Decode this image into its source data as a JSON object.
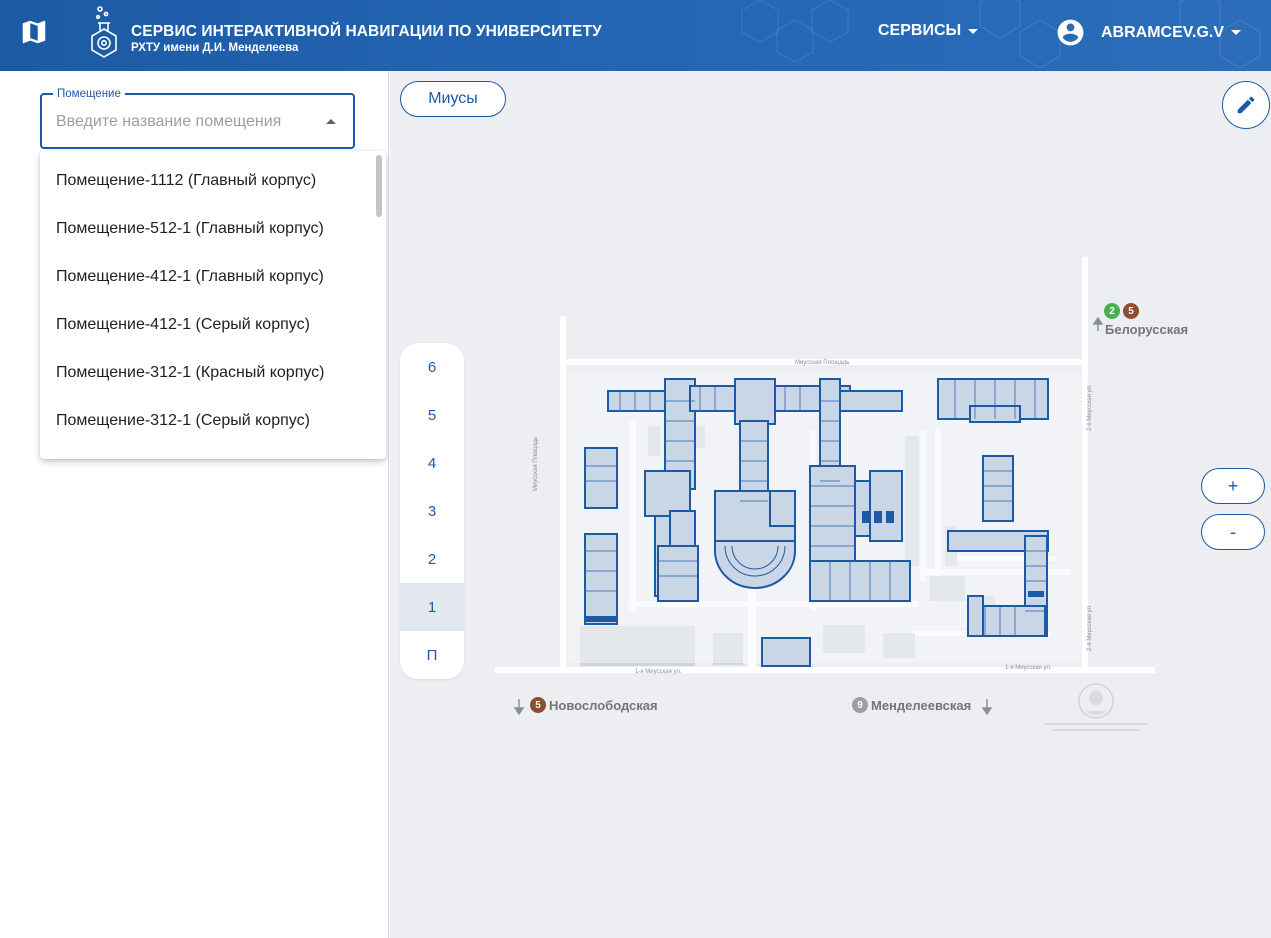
{
  "header": {
    "title": "СЕРВИС ИНТЕРАКТИВНОЙ НАВИГАЦИИ ПО УНИВЕРСИТЕТУ",
    "subtitle": "РХТУ имени Д.И. Менделеева",
    "services_label": "СЕРВИСЫ",
    "user_label": "ABRAMCEV.G.V",
    "map_icon": "map-icon",
    "logo_icon": "flask-logo-icon",
    "user_icon": "account-circle-icon"
  },
  "search": {
    "label": "Помещение",
    "placeholder": "Введите название помещения",
    "options": [
      "Помещение-1112 (Главный корпус)",
      "Помещение-512-1 (Главный корпус)",
      "Помещение-412-1 (Главный корпус)",
      "Помещение-412-1 (Серый корпус)",
      "Помещение-312-1 (Красный корпус)",
      "Помещение-312-1 (Серый корпус)"
    ]
  },
  "map": {
    "campus_label": "Миусы",
    "edit_icon": "pencil-icon",
    "floors": [
      "6",
      "5",
      "4",
      "3",
      "2",
      "1",
      "П"
    ],
    "active_floor": "1",
    "zoom_in": "+",
    "zoom_out": "-",
    "metro": {
      "belorusskaya": {
        "lines": [
          "2",
          "5"
        ],
        "name": "Белорусская"
      },
      "novoslobodskaya": {
        "line": "5",
        "name": "Новослободская"
      },
      "mendeleevskaya": {
        "line": "9",
        "name": "Менделеевская"
      }
    },
    "streets": {
      "top": "Миусская Площадь",
      "left": "Миусская Площадь",
      "right_top": "2-я Миусская ул.",
      "right_bottom": "2-я Миусская ул.",
      "bottom_left": "1-я Миусская ул.",
      "bottom_right": "1-я Миусская ул."
    }
  },
  "colors": {
    "primary": "#1c5aa5",
    "line_green": "#4caf50",
    "line_brown": "#8d4e2e",
    "line_gray": "#9e9e9e",
    "building": "#1c5aa5",
    "map_bg": "#eceef2"
  }
}
